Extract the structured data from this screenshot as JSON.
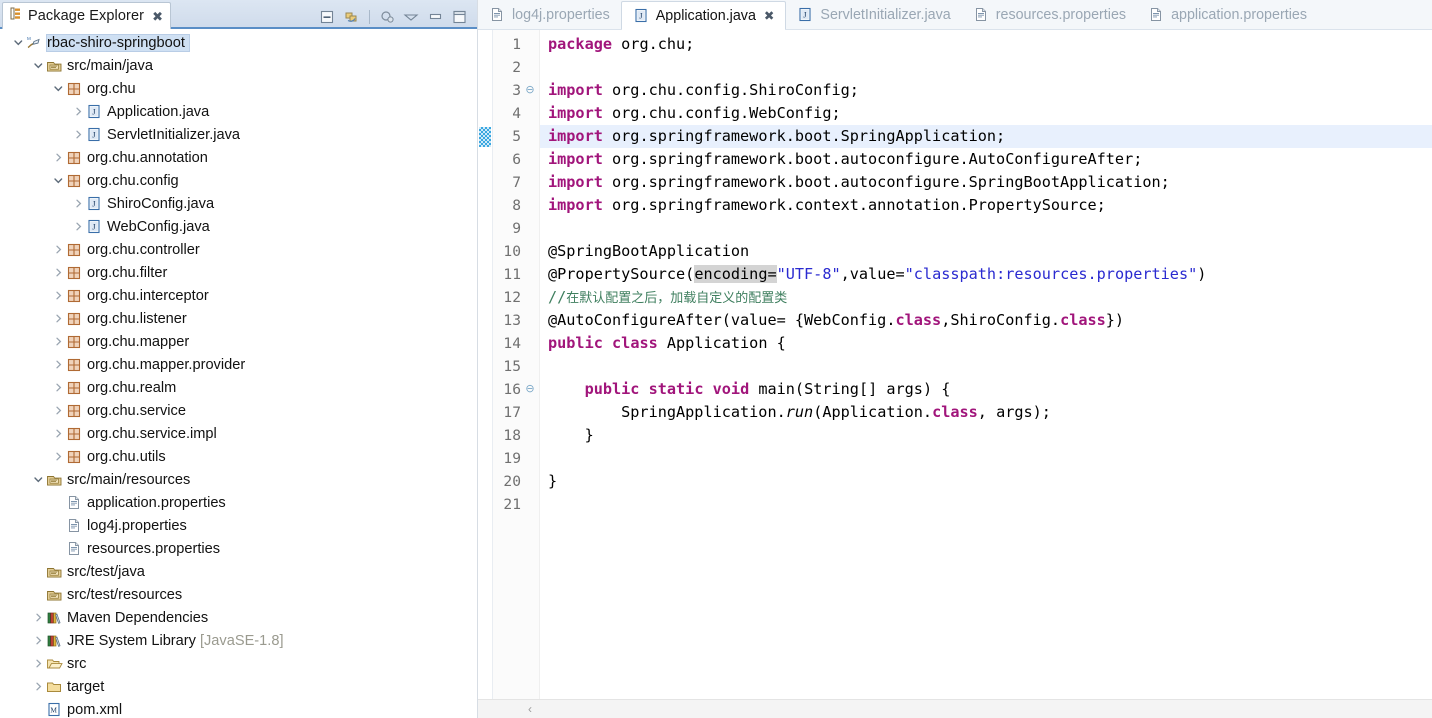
{
  "view": {
    "tab_title": "Package Explorer",
    "close_glyph": "✖",
    "toolbar": [
      {
        "name": "collapse-all-icon",
        "tooltip": "Collapse All"
      },
      {
        "name": "link-with-editor-icon",
        "tooltip": "Link with Editor"
      },
      {
        "name": "focus-on-active-task-icon",
        "tooltip": "Focus on Active Task"
      },
      {
        "name": "view-menu-icon",
        "tooltip": "View Menu"
      },
      {
        "name": "minimize-icon",
        "tooltip": "Minimize"
      },
      {
        "name": "maximize-icon",
        "tooltip": "Maximize"
      }
    ]
  },
  "tree": [
    {
      "label": "rbac-shiro-springboot",
      "icon": "maven-project-icon",
      "indent": 0,
      "arrow": "down",
      "selected": true,
      "suffix": ""
    },
    {
      "label": "src/main/java",
      "icon": "source-folder-icon",
      "indent": 1,
      "arrow": "down",
      "selected": false,
      "suffix": ""
    },
    {
      "label": "org.chu",
      "icon": "package-icon",
      "indent": 2,
      "arrow": "down",
      "selected": false,
      "suffix": ""
    },
    {
      "label": "Application.java",
      "icon": "java-file-icon",
      "indent": 3,
      "arrow": "right",
      "selected": false,
      "suffix": ""
    },
    {
      "label": "ServletInitializer.java",
      "icon": "java-file-icon",
      "indent": 3,
      "arrow": "right",
      "selected": false,
      "suffix": ""
    },
    {
      "label": "org.chu.annotation",
      "icon": "package-icon",
      "indent": 2,
      "arrow": "right",
      "selected": false,
      "suffix": ""
    },
    {
      "label": "org.chu.config",
      "icon": "package-icon",
      "indent": 2,
      "arrow": "down",
      "selected": false,
      "suffix": ""
    },
    {
      "label": "ShiroConfig.java",
      "icon": "java-file-icon",
      "indent": 3,
      "arrow": "right",
      "selected": false,
      "suffix": ""
    },
    {
      "label": "WebConfig.java",
      "icon": "java-file-icon",
      "indent": 3,
      "arrow": "right",
      "selected": false,
      "suffix": ""
    },
    {
      "label": "org.chu.controller",
      "icon": "package-icon",
      "indent": 2,
      "arrow": "right",
      "selected": false,
      "suffix": ""
    },
    {
      "label": "org.chu.filter",
      "icon": "package-icon",
      "indent": 2,
      "arrow": "right",
      "selected": false,
      "suffix": ""
    },
    {
      "label": "org.chu.interceptor",
      "icon": "package-icon",
      "indent": 2,
      "arrow": "right",
      "selected": false,
      "suffix": ""
    },
    {
      "label": "org.chu.listener",
      "icon": "package-icon",
      "indent": 2,
      "arrow": "right",
      "selected": false,
      "suffix": ""
    },
    {
      "label": "org.chu.mapper",
      "icon": "package-icon",
      "indent": 2,
      "arrow": "right",
      "selected": false,
      "suffix": ""
    },
    {
      "label": "org.chu.mapper.provider",
      "icon": "package-icon",
      "indent": 2,
      "arrow": "right",
      "selected": false,
      "suffix": ""
    },
    {
      "label": "org.chu.realm",
      "icon": "package-icon",
      "indent": 2,
      "arrow": "right",
      "selected": false,
      "suffix": ""
    },
    {
      "label": "org.chu.service",
      "icon": "package-icon",
      "indent": 2,
      "arrow": "right",
      "selected": false,
      "suffix": ""
    },
    {
      "label": "org.chu.service.impl",
      "icon": "package-icon",
      "indent": 2,
      "arrow": "right",
      "selected": false,
      "suffix": ""
    },
    {
      "label": "org.chu.utils",
      "icon": "package-icon",
      "indent": 2,
      "arrow": "right",
      "selected": false,
      "suffix": ""
    },
    {
      "label": "src/main/resources",
      "icon": "source-folder-icon",
      "indent": 1,
      "arrow": "down",
      "selected": false,
      "suffix": ""
    },
    {
      "label": "application.properties",
      "icon": "properties-file-icon",
      "indent": 2,
      "arrow": "none",
      "selected": false,
      "suffix": ""
    },
    {
      "label": "log4j.properties",
      "icon": "properties-file-icon",
      "indent": 2,
      "arrow": "none",
      "selected": false,
      "suffix": ""
    },
    {
      "label": "resources.properties",
      "icon": "properties-file-icon",
      "indent": 2,
      "arrow": "none",
      "selected": false,
      "suffix": ""
    },
    {
      "label": "src/test/java",
      "icon": "source-folder-icon",
      "indent": 1,
      "arrow": "none",
      "selected": false,
      "suffix": ""
    },
    {
      "label": "src/test/resources",
      "icon": "source-folder-icon",
      "indent": 1,
      "arrow": "none",
      "selected": false,
      "suffix": ""
    },
    {
      "label": "Maven Dependencies",
      "icon": "library-icon",
      "indent": 1,
      "arrow": "right",
      "selected": false,
      "suffix": ""
    },
    {
      "label": "JRE System Library",
      "icon": "library-icon",
      "indent": 1,
      "arrow": "right",
      "selected": false,
      "suffix": " [JavaSE-1.8]"
    },
    {
      "label": "src",
      "icon": "folder-open-icon",
      "indent": 1,
      "arrow": "right",
      "selected": false,
      "suffix": ""
    },
    {
      "label": "target",
      "icon": "folder-icon",
      "indent": 1,
      "arrow": "right",
      "selected": false,
      "suffix": ""
    },
    {
      "label": "pom.xml",
      "icon": "xml-file-icon",
      "indent": 1,
      "arrow": "none",
      "selected": false,
      "suffix": ""
    }
  ],
  "editor": {
    "tabs": [
      {
        "label": "log4j.properties",
        "icon": "properties-file-icon",
        "active": false
      },
      {
        "label": "Application.java",
        "icon": "java-file-icon",
        "active": true
      },
      {
        "label": "ServletInitializer.java",
        "icon": "java-file-icon",
        "active": false
      },
      {
        "label": "resources.properties",
        "icon": "properties-file-icon",
        "active": false
      },
      {
        "label": "application.properties",
        "icon": "properties-file-icon",
        "active": false
      }
    ],
    "active_tab_close_glyph": "✖",
    "current_line": 5,
    "line_numbers": [
      1,
      2,
      3,
      4,
      5,
      6,
      7,
      8,
      9,
      10,
      11,
      12,
      13,
      14,
      15,
      16,
      17,
      18,
      19,
      20,
      21
    ],
    "fold_markers": {
      "3": "⊖",
      "16": "⊖"
    },
    "lines": [
      {
        "n": 1,
        "t": "package org.chu;"
      },
      {
        "n": 2,
        "t": ""
      },
      {
        "n": 3,
        "t": "import org.chu.config.ShiroConfig;"
      },
      {
        "n": 4,
        "t": "import org.chu.config.WebConfig;"
      },
      {
        "n": 5,
        "t": "import org.springframework.boot.SpringApplication;"
      },
      {
        "n": 6,
        "t": "import org.springframework.boot.autoconfigure.AutoConfigureAfter;"
      },
      {
        "n": 7,
        "t": "import org.springframework.boot.autoconfigure.SpringBootApplication;"
      },
      {
        "n": 8,
        "t": "import org.springframework.context.annotation.PropertySource;"
      },
      {
        "n": 9,
        "t": ""
      },
      {
        "n": 10,
        "t": "@SpringBootApplication"
      },
      {
        "n": 11,
        "t": "@PropertySource(encoding=\"UTF-8\",value=\"classpath:resources.properties\")"
      },
      {
        "n": 12,
        "t": "//在默认配置之后，加载自定义的配置类"
      },
      {
        "n": 13,
        "t": "@AutoConfigureAfter(value= {WebConfig.class,ShiroConfig.class})"
      },
      {
        "n": 14,
        "t": "public class Application {"
      },
      {
        "n": 15,
        "t": ""
      },
      {
        "n": 16,
        "t": "    public static void main(String[] args) {"
      },
      {
        "n": 17,
        "t": "        SpringApplication.run(Application.class, args);"
      },
      {
        "n": 18,
        "t": "    }"
      },
      {
        "n": 19,
        "t": ""
      },
      {
        "n": 20,
        "t": "}"
      },
      {
        "n": 21,
        "t": ""
      }
    ],
    "scroll_left_arrow": "‹"
  },
  "colors": {
    "keyword": "#a1157b",
    "string": "#2a2ad0",
    "comment": "#3f7f5f",
    "current_line_bg": "#e8f0fd",
    "selection_bg": "#cfe0f3",
    "tab_active_bg": "#ffffff",
    "view_tabbar_gradient_top": "#dce6f2",
    "view_tabbar_accent": "#5a8ec6",
    "annotation_marker": "#3aa7e0"
  }
}
